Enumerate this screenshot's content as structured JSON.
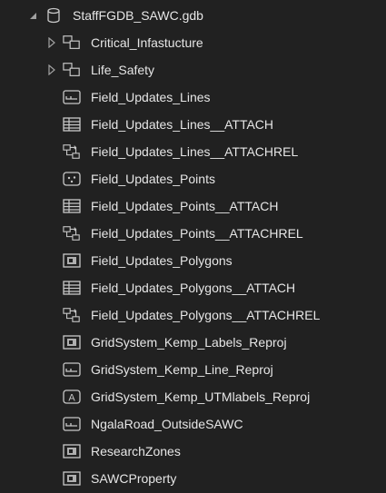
{
  "tree": {
    "root": {
      "label": "StaffFGDB_SAWC.gdb",
      "icon": "geodatabase-icon",
      "expanded": true
    },
    "items": [
      {
        "label": "Critical_Infastucture",
        "icon": "feature-dataset-icon",
        "expandable": true
      },
      {
        "label": "Life_Safety",
        "icon": "feature-dataset-icon",
        "expandable": true
      },
      {
        "label": "Field_Updates_Lines",
        "icon": "line-feature-class-icon"
      },
      {
        "label": "Field_Updates_Lines__ATTACH",
        "icon": "table-icon"
      },
      {
        "label": "Field_Updates_Lines__ATTACHREL",
        "icon": "relationship-class-icon"
      },
      {
        "label": "Field_Updates_Points",
        "icon": "point-feature-class-icon"
      },
      {
        "label": "Field_Updates_Points__ATTACH",
        "icon": "table-icon"
      },
      {
        "label": "Field_Updates_Points__ATTACHREL",
        "icon": "relationship-class-icon"
      },
      {
        "label": "Field_Updates_Polygons",
        "icon": "polygon-feature-class-icon"
      },
      {
        "label": "Field_Updates_Polygons__ATTACH",
        "icon": "table-icon"
      },
      {
        "label": "Field_Updates_Polygons__ATTACHREL",
        "icon": "relationship-class-icon"
      },
      {
        "label": "GridSystem_Kemp_Labels_Reproj",
        "icon": "polygon-feature-class-icon"
      },
      {
        "label": "GridSystem_Kemp_Line_Reproj",
        "icon": "line-feature-class-icon"
      },
      {
        "label": "GridSystem_Kemp_UTMlabels_Reproj",
        "icon": "annotation-feature-class-icon",
        "glyph": "A"
      },
      {
        "label": "NgalaRoad_OutsideSAWC",
        "icon": "line-feature-class-icon"
      },
      {
        "label": "ResearchZones",
        "icon": "polygon-feature-class-icon"
      },
      {
        "label": "SAWCProperty",
        "icon": "polygon-feature-class-icon"
      }
    ]
  },
  "colors": {
    "background": "#212121",
    "text": "#e6e6e6",
    "icon": "#c8c8c8",
    "expander": "#a0a0a0"
  }
}
